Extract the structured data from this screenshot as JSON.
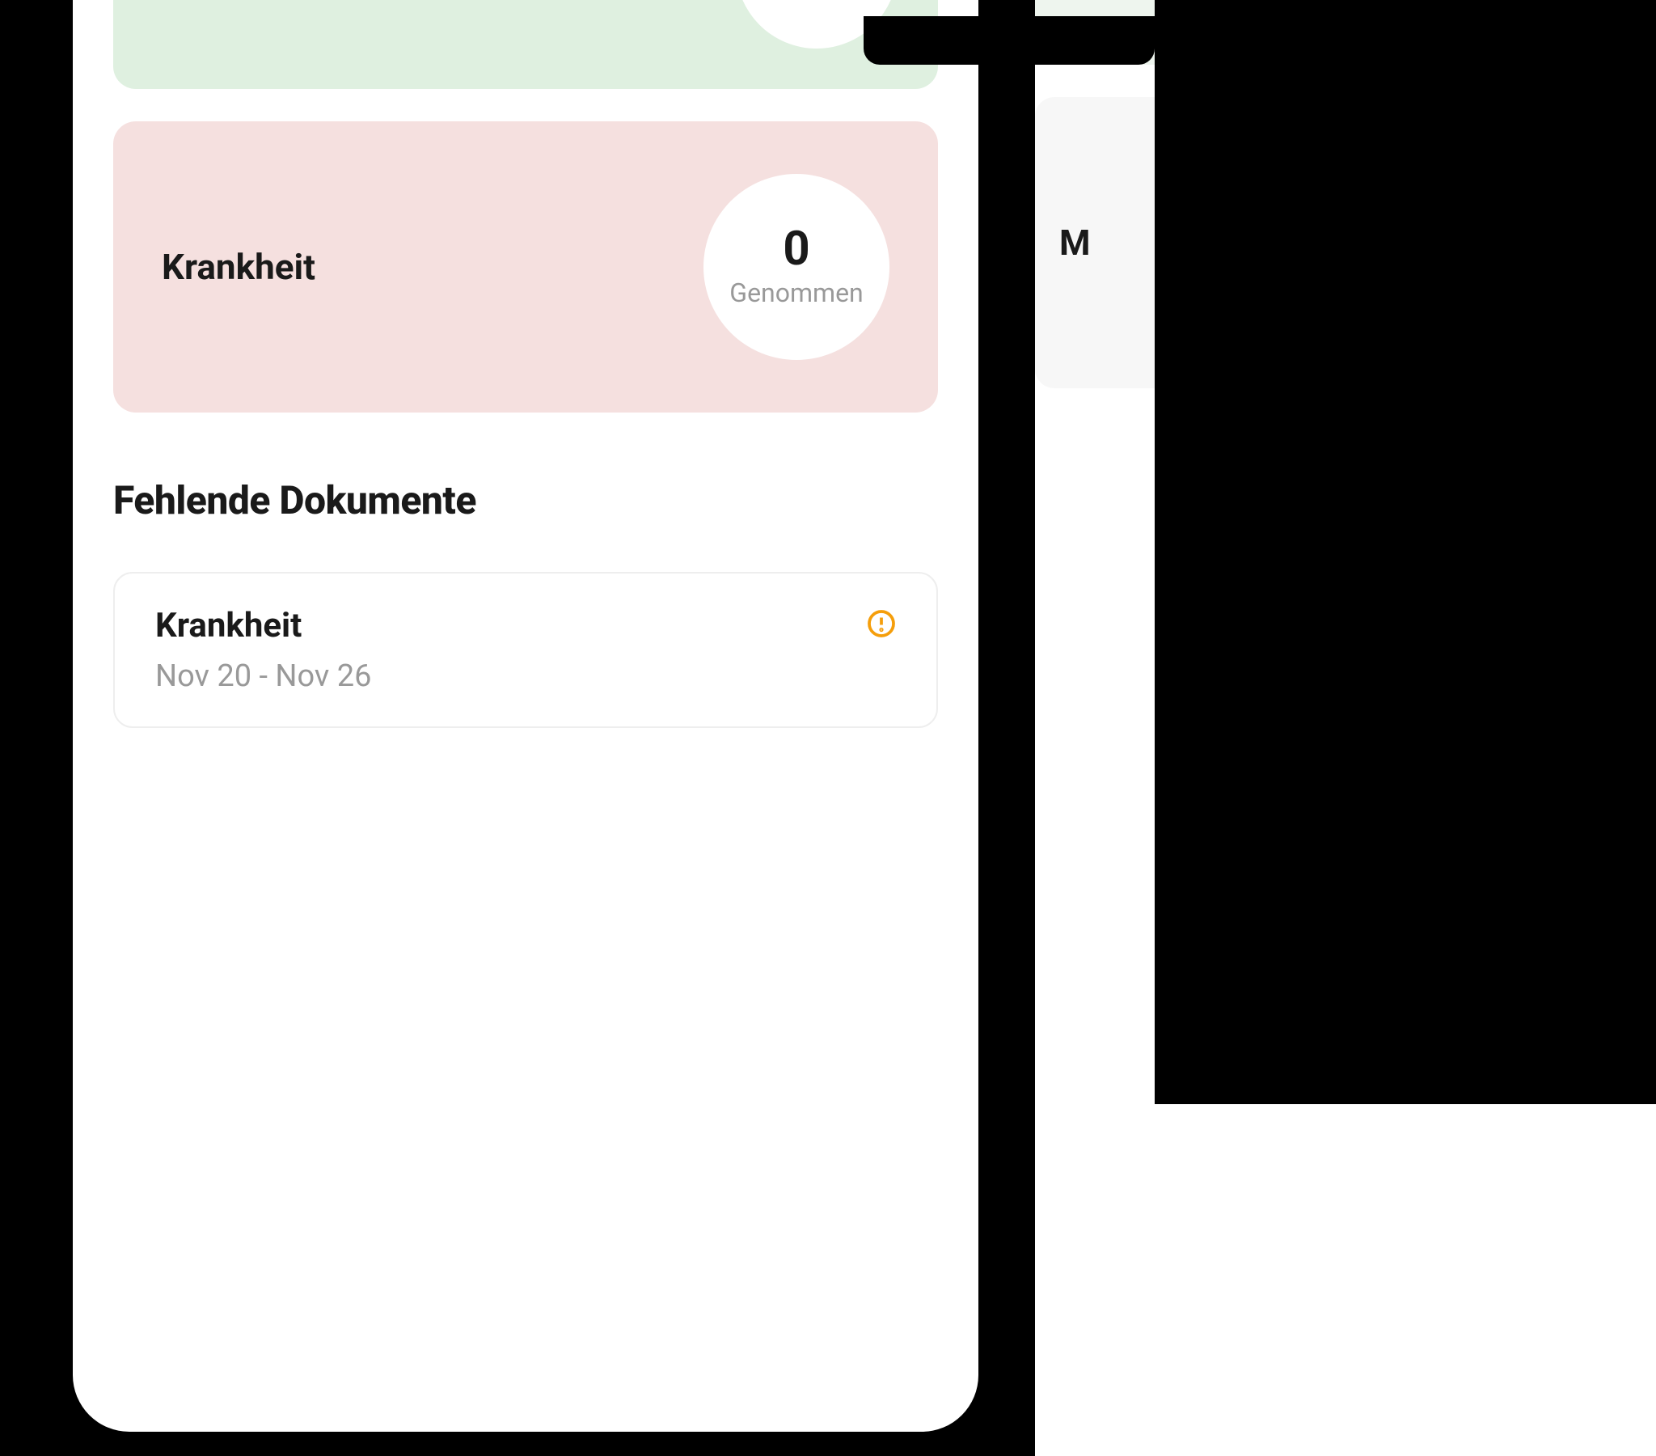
{
  "cards": {
    "sickness": {
      "title": "Krankheit",
      "value": "0",
      "label": "Genommen"
    },
    "side_letter": "M"
  },
  "missing_docs": {
    "heading": "Fehlende Dokumente",
    "items": [
      {
        "title": "Krankheit",
        "date_range": "Nov 20 - Nov 26"
      }
    ]
  },
  "colors": {
    "green_card": "#dff0e0",
    "pink_card": "#f5e0df",
    "alert_orange": "#f59e0b"
  }
}
